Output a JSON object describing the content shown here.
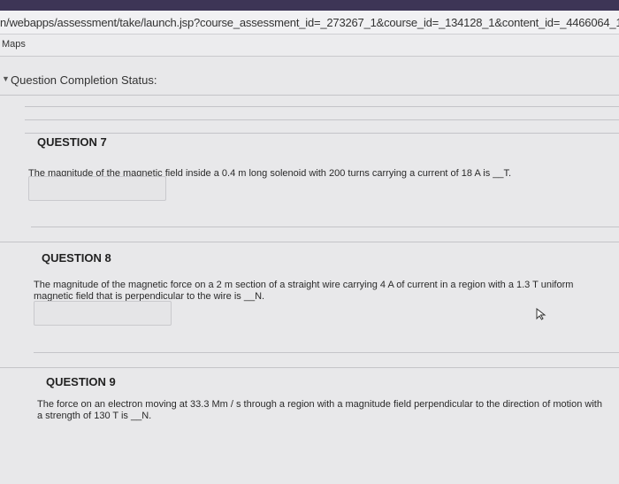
{
  "browser": {
    "url": "n/webapps/assessment/take/launch.jsp?course_assessment_id=_273267_1&course_id=_134128_1&content_id=_4466064_1&",
    "bookmarks": [
      {
        "label": "Maps"
      }
    ]
  },
  "status": {
    "label": "Question Completion Status:"
  },
  "questions": [
    {
      "title": "QUESTION 7",
      "text": "The magnitude of the magnetic field inside a 0.4 m long solenoid with 200 turns carrying a current of 18 A is __T.",
      "answer_value": ""
    },
    {
      "title": "QUESTION 8",
      "text": "The magnitude of the magnetic force on a 2 m section of a straight wire carrying 4 A of current in a region with a 1.3 T uniform magnetic field that is perpendicular to the wire is __N.",
      "answer_value": ""
    },
    {
      "title": "QUESTION 9",
      "text": "The force on an electron moving at 33.3 Mm / s through a region with a magnitude field perpendicular to the direction of motion with a strength of 130 T is __N."
    }
  ]
}
